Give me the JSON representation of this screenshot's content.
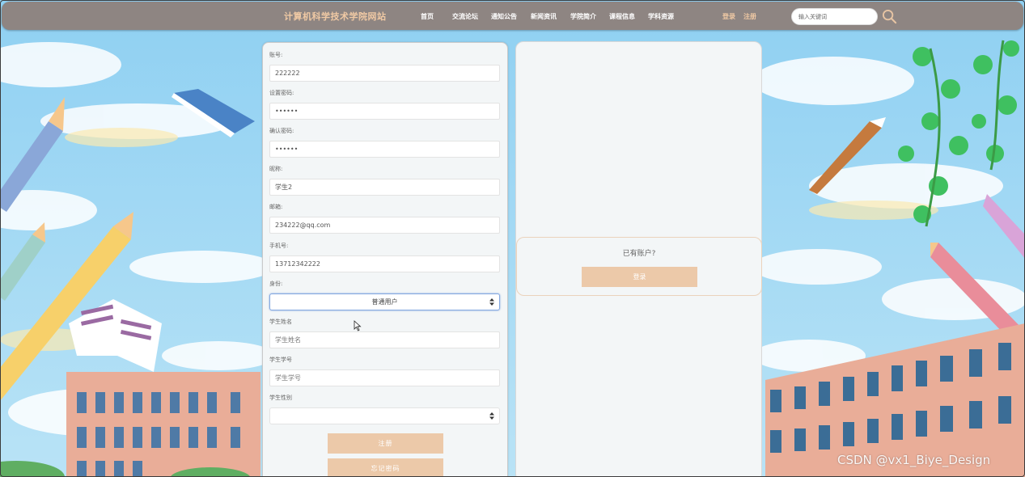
{
  "header": {
    "site_title": "计算机科学技术学院网站",
    "nav": [
      "首页",
      "交流论坛",
      "通知公告",
      "新闻资讯",
      "学院简介",
      "课程信息",
      "学科资源"
    ],
    "login_link": "登录",
    "register_link": "注册",
    "search_placeholder": "输入关键词"
  },
  "form": {
    "fields": [
      {
        "label": "账号:",
        "value": "222222",
        "placeholder": ""
      },
      {
        "label": "设置密码:",
        "value": "••••••",
        "placeholder": ""
      },
      {
        "label": "确认密码:",
        "value": "••••••",
        "placeholder": ""
      },
      {
        "label": "昵称:",
        "value": "学生2",
        "placeholder": ""
      },
      {
        "label": "邮箱:",
        "value": "234222@qq.com",
        "placeholder": ""
      },
      {
        "label": "手机号:",
        "value": "13712342222",
        "placeholder": ""
      }
    ],
    "role_label": "身份:",
    "role_value": "普通用户",
    "student_name_label": "学生姓名",
    "student_name_placeholder": "学生姓名",
    "student_no_label": "学生学号",
    "student_no_placeholder": "学生学号",
    "gender_label": "学生性别",
    "gender_value": "",
    "register_button": "注册",
    "forgot_button": "忘记密码"
  },
  "side": {
    "prompt": "已有账户?",
    "login_button": "登录"
  },
  "watermark": "CSDN @vx1_Biye_Design",
  "colors": {
    "topbar": "#8e8582",
    "accent": "#ecc9a9",
    "title": "#f0c9a4",
    "panel": "#f3f6f7"
  }
}
